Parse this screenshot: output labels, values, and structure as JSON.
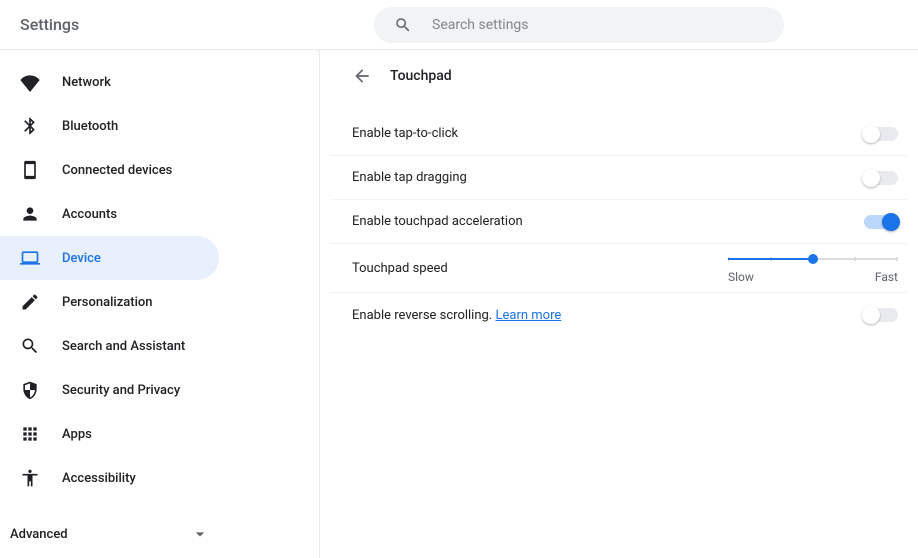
{
  "header": {
    "title": "Settings",
    "search_placeholder": "Search settings"
  },
  "sidebar": {
    "items": [
      {
        "icon": "wifi-icon",
        "label": "Network"
      },
      {
        "icon": "bluetooth-icon",
        "label": "Bluetooth"
      },
      {
        "icon": "phone-icon",
        "label": "Connected devices"
      },
      {
        "icon": "account-icon",
        "label": "Accounts"
      },
      {
        "icon": "device-icon",
        "label": "Device",
        "active": true
      },
      {
        "icon": "personalization-icon",
        "label": "Personalization"
      },
      {
        "icon": "search-assistant-icon",
        "label": "Search and Assistant"
      },
      {
        "icon": "security-icon",
        "label": "Security and Privacy"
      },
      {
        "icon": "apps-icon",
        "label": "Apps"
      },
      {
        "icon": "accessibility-icon",
        "label": "Accessibility"
      }
    ],
    "advanced_label": "Advanced"
  },
  "page": {
    "title": "Touchpad",
    "rows": {
      "tap_to_click": {
        "label": "Enable tap-to-click",
        "value": false
      },
      "tap_dragging": {
        "label": "Enable tap dragging",
        "value": false
      },
      "acceleration": {
        "label": "Enable touchpad acceleration",
        "value": true
      },
      "speed": {
        "label": "Touchpad speed",
        "slow_label": "Slow",
        "fast_label": "Fast",
        "value": 3,
        "max": 5
      },
      "reverse_scrolling": {
        "label": "Enable reverse scrolling. ",
        "learn_more": "Learn more",
        "value": false
      }
    }
  },
  "colors": {
    "accent": "#1a73e8"
  }
}
